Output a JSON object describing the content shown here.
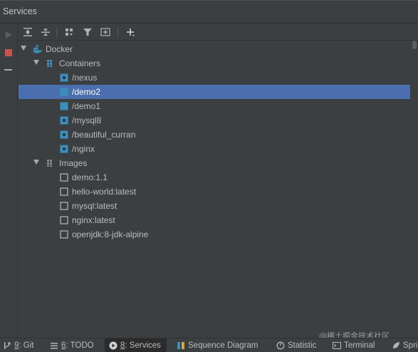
{
  "panel": {
    "title": "Services"
  },
  "tree": {
    "root": {
      "label": "Docker",
      "icon": "docker-icon"
    },
    "containers": {
      "label": "Containers",
      "items": [
        {
          "label": "/nexus",
          "state": "running"
        },
        {
          "label": "/demo2",
          "state": "stopped",
          "selected": true
        },
        {
          "label": "/demo1",
          "state": "stopped"
        },
        {
          "label": "/mysql8",
          "state": "running"
        },
        {
          "label": "/beautiful_curran",
          "state": "running"
        },
        {
          "label": "/nginx",
          "state": "running"
        }
      ]
    },
    "images": {
      "label": "Images",
      "items": [
        {
          "label": "demo:1.1"
        },
        {
          "label": "hello-world:latest"
        },
        {
          "label": "mysql:latest"
        },
        {
          "label": "nginx:latest"
        },
        {
          "label": "openjdk:8-jdk-alpine"
        }
      ]
    }
  },
  "statusbar": {
    "tabs": [
      {
        "num": "9",
        "label": ": Git",
        "icon": "git-branch-icon"
      },
      {
        "num": "6",
        "label": ": TODO",
        "icon": "todo-list-icon"
      },
      {
        "num": "8",
        "label": ": Services",
        "icon": "services-icon",
        "active": true
      },
      {
        "num": "",
        "label": "Sequence Diagram",
        "icon": "sequence-diagram-icon"
      },
      {
        "num": "",
        "label": "Statistic",
        "icon": "statistic-icon"
      },
      {
        "num": "",
        "label": "Terminal",
        "icon": "terminal-icon"
      },
      {
        "num": "",
        "label": "Spri",
        "icon": "spring-icon"
      }
    ]
  },
  "watermark": "@稀土掘金技术社区",
  "colors": {
    "background": "#3c3f41",
    "selection": "#4b6eaf",
    "running_container": "#3d8eb9",
    "stop_button": "#c75450"
  }
}
